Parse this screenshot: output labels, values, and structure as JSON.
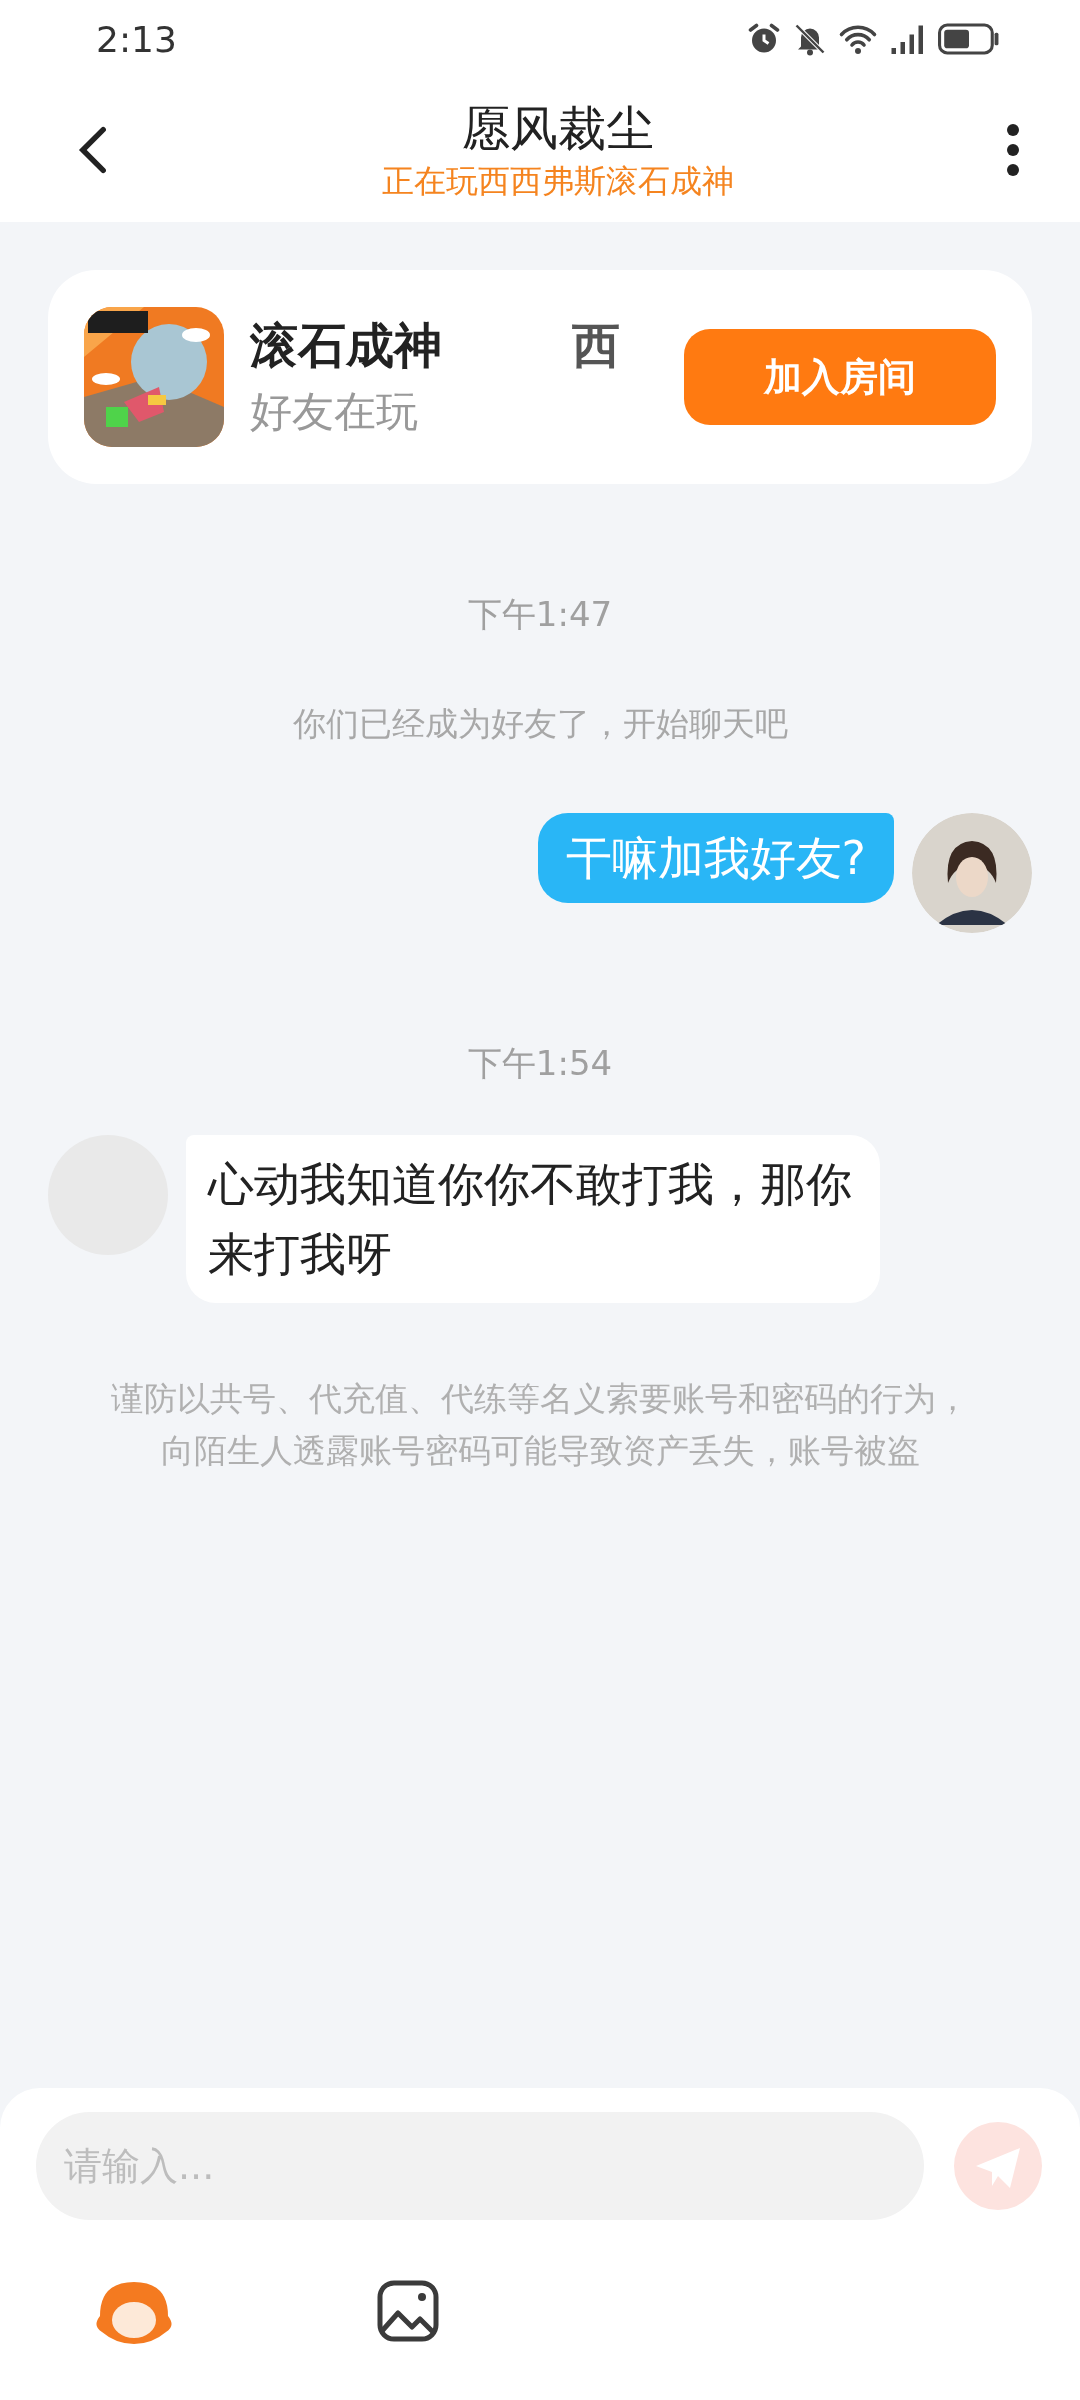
{
  "status_bar": {
    "time": "2:13"
  },
  "header": {
    "title": "愿风裁尘",
    "subtitle": "正在玩西西弗斯滚石成神"
  },
  "game_card": {
    "title_parts": [
      "滚石成神",
      "西"
    ],
    "subtitle": "好友在玩",
    "button": "加入房间"
  },
  "messages": [
    {
      "kind": "time",
      "text": "下午1:47"
    },
    {
      "kind": "system",
      "text": "你们已经成为好友了，开始聊天吧"
    },
    {
      "kind": "outgoing",
      "text": "干嘛加我好友?"
    },
    {
      "kind": "time",
      "text": "下午1:54"
    },
    {
      "kind": "incoming",
      "text": "心动我知道你你不敢打我，那你来打我呀"
    },
    {
      "kind": "notice",
      "text": "谨防以共号、代充值、代练等名义索要账号和密码的行为，向陌生人透露账号密码可能导致资产丢失，账号被盗"
    }
  ],
  "composer": {
    "placeholder": "请输入..."
  }
}
